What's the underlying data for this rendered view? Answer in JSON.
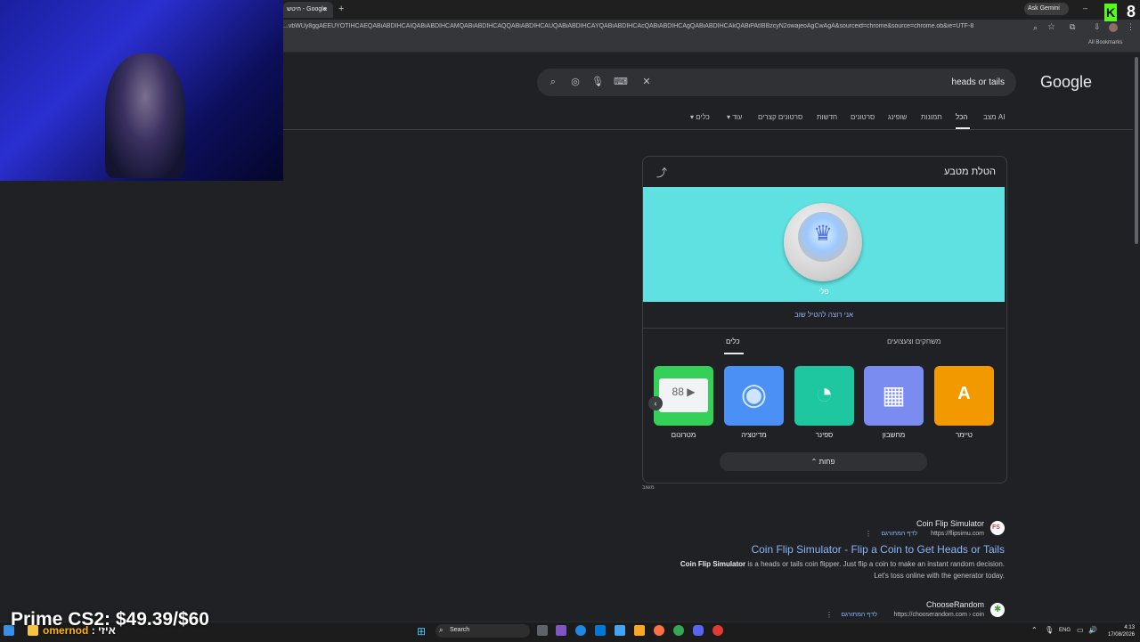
{
  "browser": {
    "tab_title": "היטש - Google",
    "url": "...vbWUy8ggAEEUYOTIHCAEQABiABDIHCAIQABiABDIHCAMQABiABDIHCAQQABiABDIHCAUQABiABDIHCAYQABiABDIHCAcQABiABDIHCAgQABiABDIHCAkQABiPAtIBBzcyN2owajeoAgCwAgA&sourceid=chrome&source=chrome.ob&ie=UTF-8",
    "ask_gemini": "Ask Gemini",
    "all_bookmarks": "All Bookmarks"
  },
  "google": {
    "logo": "Google",
    "query": "heads or tails",
    "nav": {
      "ai_mode": "מצב AI",
      "all": "הכל",
      "images": "תמונות",
      "shopping": "שופינג",
      "videos": "סרטונים",
      "news": "חדשות",
      "short_videos": "סרטונים קצרים",
      "more": "עוד",
      "tools": "כלים"
    }
  },
  "card": {
    "title": "הטלת מטבע",
    "coin_result": "פלי",
    "flip_again": "אני רוצה להטיל שוב",
    "tabs": {
      "games": "משחקים וצעצועים",
      "tools": "כלים"
    },
    "tools": [
      {
        "label": "טיימר",
        "color": "#f29900",
        "glyph": "A"
      },
      {
        "label": "מחשבון",
        "color": "#7b8cf0",
        "glyph": "▦"
      },
      {
        "label": "ספינר",
        "color": "#1fc7a1",
        "glyph": "◔"
      },
      {
        "label": "מדיטציה",
        "color": "#4a90f5",
        "glyph": "◉"
      },
      {
        "label": "מטרונום",
        "color": "#34d058",
        "glyph": "88 ▶"
      }
    ],
    "less": "פחות",
    "feedback": "משוב"
  },
  "results": [
    {
      "site": "Coin Flip Simulator",
      "url": "https://flipsimu.com",
      "translate": "לדף המתורגם",
      "title": "Coin Flip Simulator - Flip a Coin to Get Heads or Tails",
      "snippet_bold": "Coin Flip Simulator",
      "snippet_rest": " is a heads or tails coin flipper. Just flip a coin to make an instant random decision.",
      "snippet_line2": "Let's toss online with the generator today."
    },
    {
      "site": "ChooseRandom",
      "url": "https://chooserandom.com › coin",
      "translate": "לדף המתורגם"
    }
  ],
  "overlay": {
    "kick_count": "8",
    "prime_text": "Prime CS2: $49.39/$60",
    "chat_user": "omernod",
    "chat_msg": ": איזי"
  },
  "taskbar": {
    "search": "Search",
    "lang": "ENG",
    "time": "4:13",
    "date": "17/08/2026"
  },
  "colors": {
    "bg": "#202124",
    "link": "#8ab4f8",
    "coin_bg": "#5ee1e0",
    "kick_green": "#53fc18"
  }
}
